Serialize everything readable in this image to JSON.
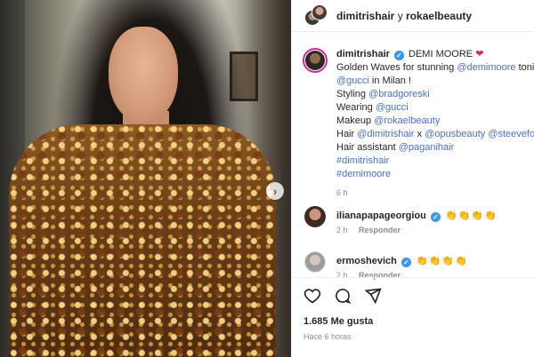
{
  "header": {
    "user_a": "dimitrishair",
    "joiner": "y",
    "user_b": "rokaelbeauty"
  },
  "caption": {
    "author": "dimitrishair",
    "lines": [
      "DEMI MOORE",
      "Golden Waves for stunning",
      "@demimoore",
      "tonight premiere of",
      "@gucci",
      "in Milan !",
      "Styling",
      "@bradgoreski",
      "Wearing",
      "@gucci",
      "Makeup",
      "@rokaelbeauty",
      "Hair",
      "@dimitrishair",
      "x",
      "@opusbeauty",
      "@steevefournier",
      "Hair assistant",
      "@paganihair",
      "#dimitrishair",
      "#demimoore"
    ],
    "time": "6 h"
  },
  "comments": [
    {
      "user": "ilianapapageorgiou",
      "text": "👏👏👏👏",
      "time": "2 h",
      "reply": "Responder"
    },
    {
      "user": "ermoshevich",
      "text": "👏👏👏👏",
      "time": "2 h",
      "reply": "Responder"
    }
  ],
  "actions": {
    "like_icon": "heart-icon",
    "comment_icon": "comment-icon",
    "share_icon": "share-icon"
  },
  "footer": {
    "likes": "1.685 Me gusta",
    "posted": "Hace 6 horas"
  },
  "colors": {
    "link": "#4a6ed6",
    "verified": "#3897f0",
    "heart": "#e0245e"
  }
}
